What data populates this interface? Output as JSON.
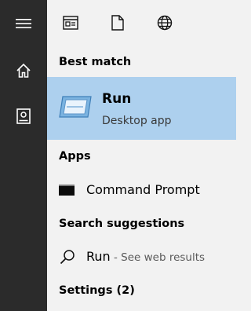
{
  "rail": {
    "menu_icon": "hamburger-icon",
    "home_icon": "home-icon",
    "notebook_icon": "notebook-icon"
  },
  "topbar": {
    "apps_icon": "apps-filter-icon",
    "documents_icon": "document-icon",
    "web_icon": "globe-icon"
  },
  "sections": {
    "best_match": "Best match",
    "apps": "Apps",
    "search_suggestions": "Search suggestions",
    "settings": "Settings (2)"
  },
  "best_match": {
    "title": "Run",
    "subtitle": "Desktop app",
    "icon": "run-icon"
  },
  "apps": [
    {
      "label": "Command Prompt",
      "icon": "cmd-icon"
    }
  ],
  "suggestions": [
    {
      "label": "Run",
      "hint": " - See web results",
      "icon": "search-icon"
    }
  ],
  "colors": {
    "rail_bg": "#2b2b2b",
    "panel_bg": "#f2f2f2",
    "highlight": "#add0ee"
  }
}
